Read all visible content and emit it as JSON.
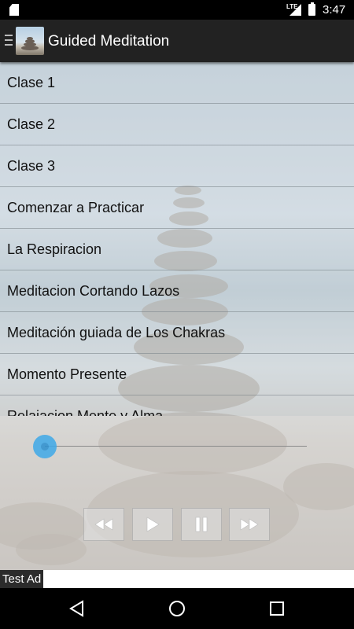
{
  "status_bar": {
    "network": "LTE",
    "time": "3:47"
  },
  "action_bar": {
    "title": "Guided Meditation"
  },
  "list": {
    "items": [
      {
        "label": "Clase 1"
      },
      {
        "label": "Clase 2"
      },
      {
        "label": "Clase 3"
      },
      {
        "label": "Comenzar a Practicar"
      },
      {
        "label": "La Respiracion"
      },
      {
        "label": "Meditacion Cortando Lazos"
      },
      {
        "label": "Meditación guiada de Los Chakras"
      },
      {
        "label": "Momento Presente"
      },
      {
        "label": "Relajacion Mente y Alma"
      }
    ]
  },
  "player": {
    "progress": 0.0,
    "controls": [
      "rewind",
      "play",
      "pause",
      "fast-forward"
    ]
  },
  "ad": {
    "label": "Test Ad"
  },
  "colors": {
    "seek_accent": "#3fa9e8",
    "action_bar": "#222222"
  }
}
